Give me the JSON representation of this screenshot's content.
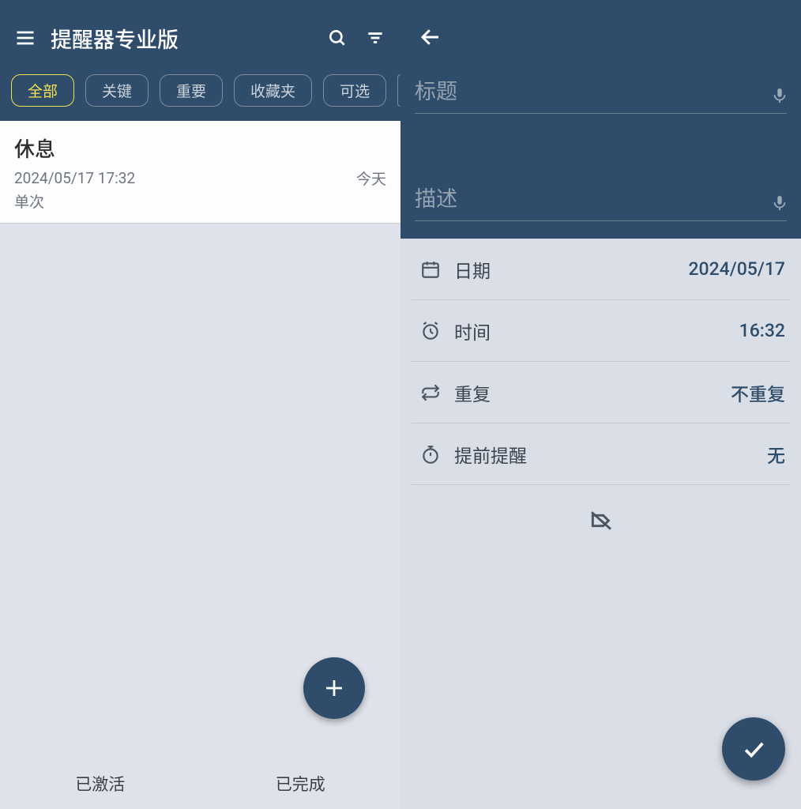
{
  "left": {
    "app_title": "提醒器专业版",
    "chips": {
      "all": "全部",
      "key": "关键",
      "important": "重要",
      "favorites": "收藏夹",
      "optional": "可选"
    },
    "item": {
      "title": "休息",
      "datetime": "2024/05/17  17:32",
      "relative": "今天",
      "repeat": "单次"
    },
    "tabs": {
      "active": "已激活",
      "done": "已完成"
    }
  },
  "right": {
    "title_placeholder": "标题",
    "desc_placeholder": "描述",
    "rows": {
      "date": {
        "label": "日期",
        "value": "2024/05/17"
      },
      "time": {
        "label": "时间",
        "value": "16:32"
      },
      "repeat": {
        "label": "重复",
        "value": "不重复"
      },
      "advance": {
        "label": "提前提醒",
        "value": "无"
      }
    }
  }
}
